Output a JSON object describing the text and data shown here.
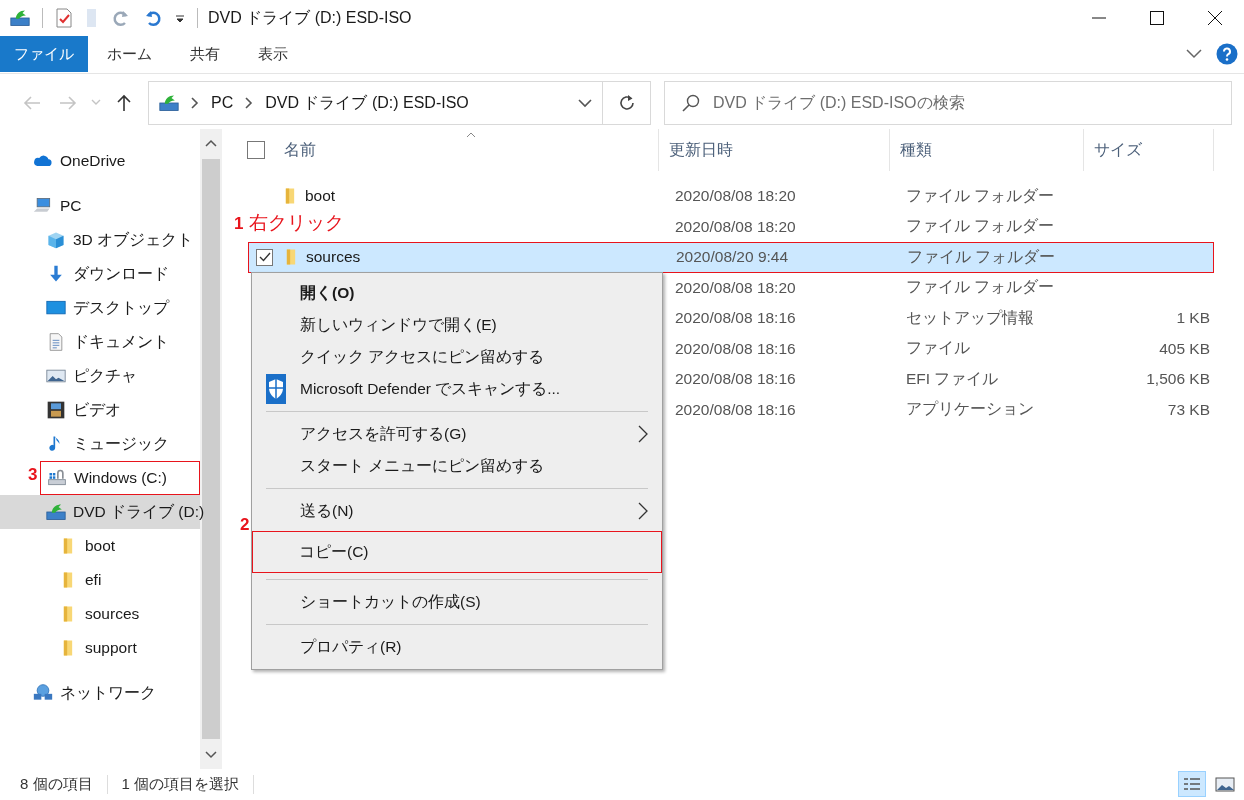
{
  "window": {
    "title": "DVD ドライブ (D:) ESD-ISO"
  },
  "ribbon_tabs": [
    {
      "label": "ファイル",
      "selected": true
    },
    {
      "label": "ホーム",
      "selected": false
    },
    {
      "label": "共有",
      "selected": false
    },
    {
      "label": "表示",
      "selected": false
    }
  ],
  "nav_buttons": [
    {
      "kind": "back",
      "disabled": true
    },
    {
      "kind": "forward",
      "disabled": true
    },
    {
      "kind": "recent",
      "disabled": true
    },
    {
      "kind": "up",
      "disabled": false
    }
  ],
  "address_bar": {
    "path": [
      "PC",
      "DVD ドライブ (D:) ESD-ISO"
    ]
  },
  "search": {
    "placeholder": "DVD ドライブ (D:) ESD-ISOの検索"
  },
  "sidebar": {
    "items": [
      {
        "label": "OneDrive",
        "kind": "cloud",
        "selected": false
      },
      {
        "label": "PC",
        "kind": "pc",
        "selected": false,
        "children": [
          {
            "label": "3D オブジェクト",
            "kind": "cube",
            "selected": false
          },
          {
            "label": "ダウンロード",
            "kind": "download",
            "selected": false
          },
          {
            "label": "デスクトップ",
            "kind": "desktop",
            "selected": false
          },
          {
            "label": "ドキュメント",
            "kind": "document",
            "selected": false
          },
          {
            "label": "ピクチャ",
            "kind": "pictures",
            "selected": false
          },
          {
            "label": "ビデオ",
            "kind": "video",
            "selected": false
          },
          {
            "label": "ミュージック",
            "kind": "music",
            "selected": false
          },
          {
            "label": "Windows (C:)",
            "kind": "drive",
            "selected": false,
            "callout": {
              "number": "3"
            }
          },
          {
            "label": "DVD ドライブ (D:)",
            "kind": "dvd",
            "selected": true,
            "children": [
              {
                "label": "boot",
                "kind": "folder",
                "selected": false
              },
              {
                "label": "efi",
                "kind": "folder",
                "selected": false
              },
              {
                "label": "sources",
                "kind": "folder",
                "selected": false
              },
              {
                "label": "support",
                "kind": "folder",
                "selected": false
              }
            ]
          }
        ]
      },
      {
        "label": "ネットワーク",
        "kind": "network",
        "selected": false
      }
    ]
  },
  "file_list": {
    "select_all_checked": false,
    "columns": [
      {
        "label": "名前",
        "sorted": true
      },
      {
        "label": "更新日時",
        "sorted": false
      },
      {
        "label": "種類",
        "sorted": false
      },
      {
        "label": "サイズ",
        "sorted": false
      }
    ],
    "rows": [
      {
        "kind": "folder",
        "name": "boot",
        "date": "2020/08/08 18:20",
        "type": "ファイル フォルダー",
        "selected": false,
        "checked": false
      },
      {
        "date": "2020/08/08 18:20",
        "type": "ファイル フォルダー",
        "selected": false,
        "checked": false
      },
      {
        "kind": "folder",
        "name": "sources",
        "date": "2020/08/20 9:44",
        "type": "ファイル フォルダー",
        "selected": true,
        "checked": true,
        "callout": {
          "number": "1",
          "text": "右クリック"
        }
      },
      {
        "date": "2020/08/08 18:20",
        "type": "ファイル フォルダー",
        "selected": false,
        "checked": false
      },
      {
        "date": "2020/08/08 18:16",
        "type": "セットアップ情報",
        "size": "1 KB",
        "selected": false,
        "checked": false
      },
      {
        "date": "2020/08/08 18:16",
        "type": "ファイル",
        "size": "405 KB",
        "selected": false,
        "checked": false
      },
      {
        "date": "2020/08/08 18:16",
        "type": "EFI ファイル",
        "size": "1,506 KB",
        "selected": false,
        "checked": false
      },
      {
        "date": "2020/08/08 18:16",
        "type": "アプリケーション",
        "size": "73 KB",
        "selected": false,
        "checked": false
      }
    ]
  },
  "context_menu": {
    "items": [
      {
        "kind": "item",
        "label": "開く(O)",
        "default": true,
        "submenu": false
      },
      {
        "kind": "item",
        "label": "新しいウィンドウで開く(E)",
        "default": false,
        "submenu": false
      },
      {
        "kind": "item",
        "label": "クイック アクセスにピン留めする",
        "default": false,
        "submenu": false
      },
      {
        "kind": "shield-item",
        "label": "Microsoft Defender でスキャンする...",
        "default": false,
        "submenu": false
      },
      {
        "kind": "separator"
      },
      {
        "kind": "item",
        "label": "アクセスを許可する(G)",
        "default": false,
        "submenu": true
      },
      {
        "kind": "item",
        "label": "スタート メニューにピン留めする",
        "default": false,
        "submenu": false
      },
      {
        "kind": "separator"
      },
      {
        "kind": "item",
        "label": "送る(N)",
        "default": false,
        "submenu": true
      },
      {
        "kind": "item",
        "label": "コピー(C)",
        "default": false,
        "submenu": false,
        "callout": {
          "number": "2"
        }
      },
      {
        "kind": "separator"
      },
      {
        "kind": "item",
        "label": "ショートカットの作成(S)",
        "default": false,
        "submenu": false
      },
      {
        "kind": "separator"
      },
      {
        "kind": "item",
        "label": "プロパティ(R)",
        "default": false,
        "submenu": false
      }
    ]
  },
  "status_bar": {
    "items": [
      "8 個の項目",
      "1 個の項目を選択"
    ],
    "view_buttons": [
      {
        "kind": "details",
        "selected": true
      },
      {
        "kind": "large-icons",
        "selected": false
      }
    ]
  }
}
